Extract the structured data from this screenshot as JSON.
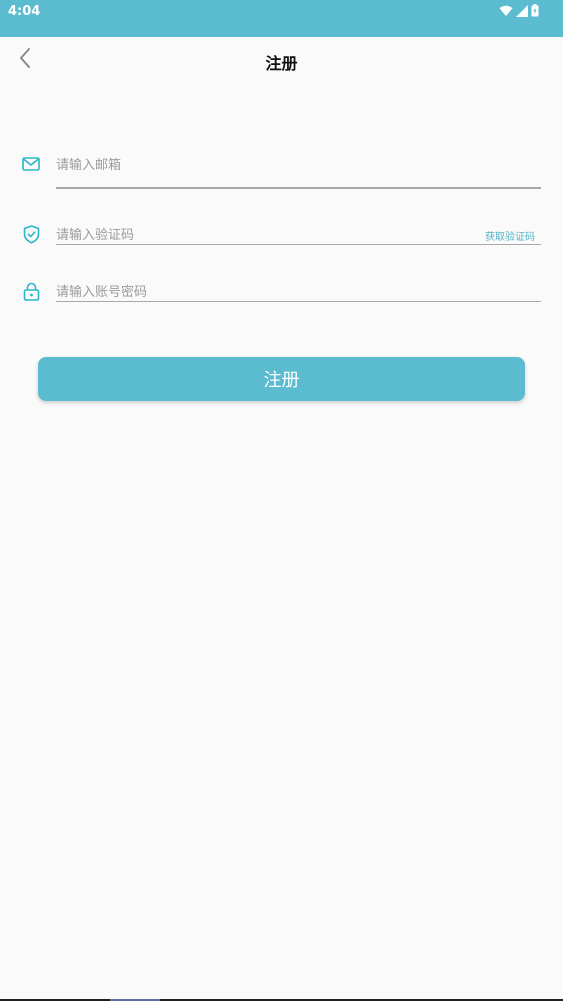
{
  "status_bar": {
    "time": "4:04",
    "icons": [
      "wifi-icon",
      "signal-icon",
      "battery-icon"
    ]
  },
  "header": {
    "back_icon": "chevron-left-icon",
    "title": "注册"
  },
  "form": {
    "email": {
      "icon": "mail-icon",
      "placeholder": "请输入邮箱",
      "value": ""
    },
    "code": {
      "icon": "shield-check-icon",
      "placeholder": "请输入验证码",
      "value": "",
      "get_code_label": "获取验证码"
    },
    "password": {
      "icon": "lock-icon",
      "placeholder": "请输入账号密码",
      "value": ""
    },
    "submit_label": "注册"
  },
  "colors": {
    "accent": "#5bbccf",
    "icon": "#2bb6cc",
    "link": "#4fb3c8",
    "background": "#fafafa"
  }
}
